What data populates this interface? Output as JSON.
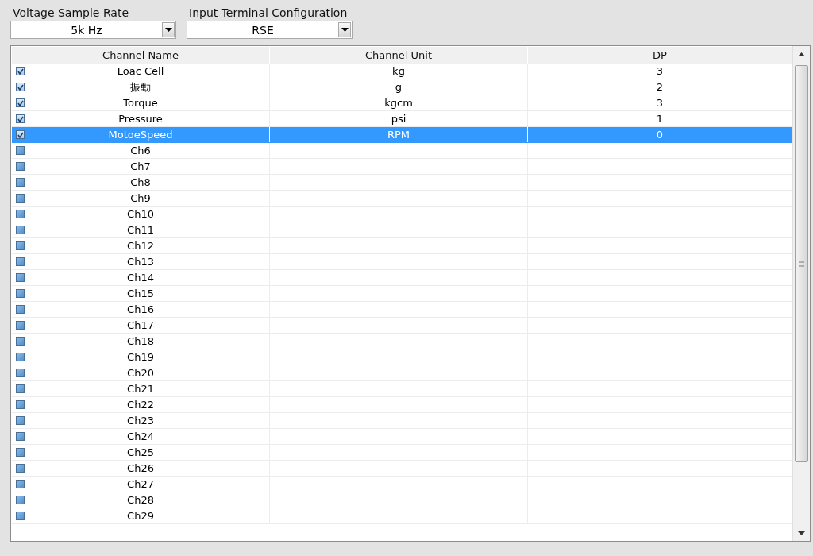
{
  "controls": [
    {
      "label": "Voltage Sample Rate",
      "value": "5k Hz"
    },
    {
      "label": "Input Terminal Configuration",
      "value": "RSE"
    }
  ],
  "table": {
    "columns": [
      "Channel Name",
      "Channel Unit",
      "DP"
    ],
    "rows": [
      {
        "name": "Loac Cell",
        "unit": "kg",
        "dp": "3",
        "checked": true,
        "selected": false
      },
      {
        "name": "振動",
        "unit": "g",
        "dp": "2",
        "checked": true,
        "selected": false
      },
      {
        "name": "Torque",
        "unit": "kgcm",
        "dp": "3",
        "checked": true,
        "selected": false
      },
      {
        "name": "Pressure",
        "unit": "psi",
        "dp": "1",
        "checked": true,
        "selected": false
      },
      {
        "name": "MotoeSpeed",
        "unit": "RPM",
        "dp": "0",
        "checked": true,
        "selected": true
      },
      {
        "name": "Ch6",
        "checked": false,
        "selected": false
      },
      {
        "name": "Ch7",
        "checked": false,
        "selected": false
      },
      {
        "name": "Ch8",
        "checked": false,
        "selected": false
      },
      {
        "name": "Ch9",
        "checked": false,
        "selected": false
      },
      {
        "name": "Ch10",
        "checked": false,
        "selected": false
      },
      {
        "name": "Ch11",
        "checked": false,
        "selected": false
      },
      {
        "name": "Ch12",
        "checked": false,
        "selected": false
      },
      {
        "name": "Ch13",
        "checked": false,
        "selected": false
      },
      {
        "name": "Ch14",
        "checked": false,
        "selected": false
      },
      {
        "name": "Ch15",
        "checked": false,
        "selected": false
      },
      {
        "name": "Ch16",
        "checked": false,
        "selected": false
      },
      {
        "name": "Ch17",
        "checked": false,
        "selected": false
      },
      {
        "name": "Ch18",
        "checked": false,
        "selected": false
      },
      {
        "name": "Ch19",
        "checked": false,
        "selected": false
      },
      {
        "name": "Ch20",
        "checked": false,
        "selected": false
      },
      {
        "name": "Ch21",
        "checked": false,
        "selected": false
      },
      {
        "name": "Ch22",
        "checked": false,
        "selected": false
      },
      {
        "name": "Ch23",
        "checked": false,
        "selected": false
      },
      {
        "name": "Ch24",
        "checked": false,
        "selected": false
      },
      {
        "name": "Ch25",
        "checked": false,
        "selected": false
      },
      {
        "name": "Ch26",
        "checked": false,
        "selected": false
      },
      {
        "name": "Ch27",
        "checked": false,
        "selected": false
      },
      {
        "name": "Ch28",
        "checked": false,
        "selected": false
      },
      {
        "name": "Ch29",
        "checked": false,
        "selected": false
      }
    ]
  }
}
